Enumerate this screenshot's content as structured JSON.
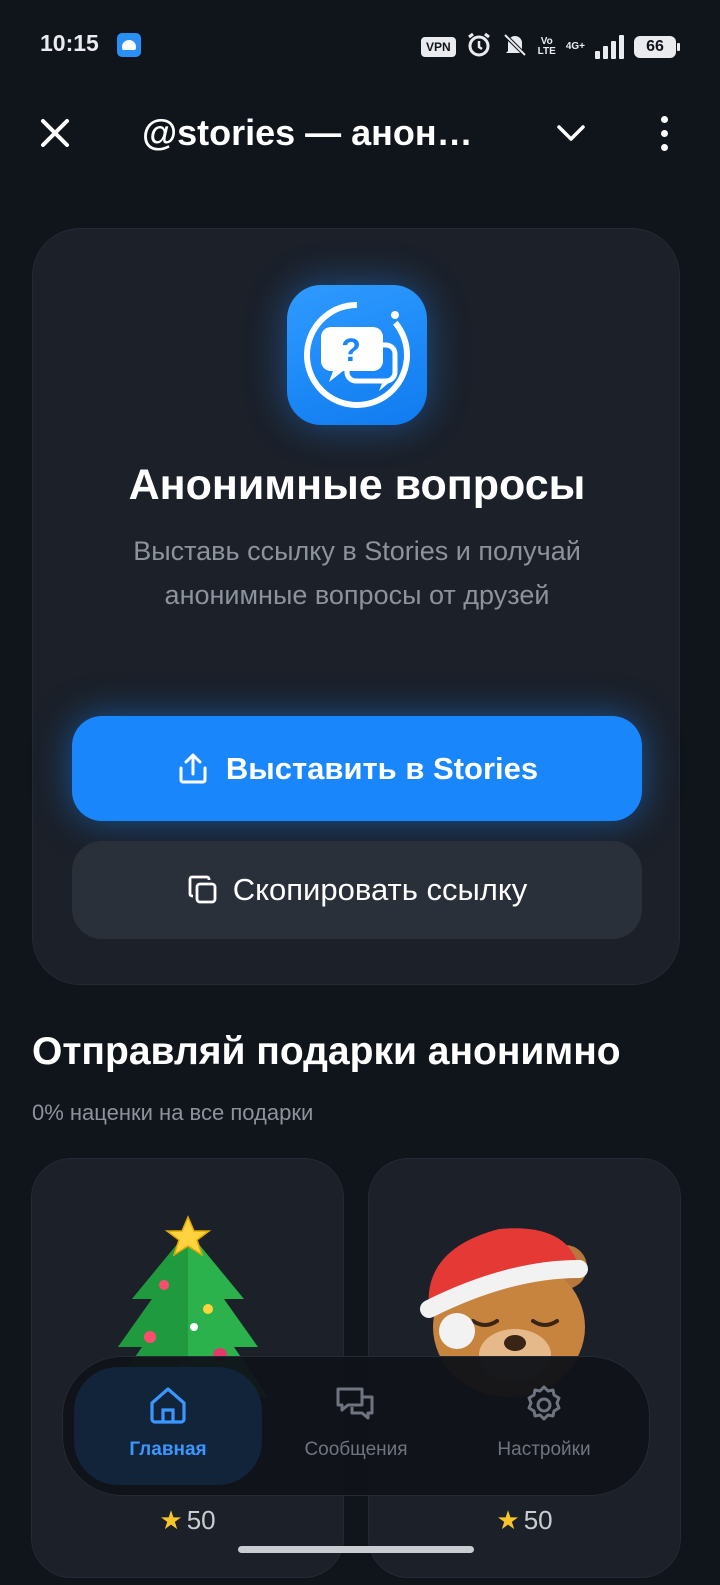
{
  "status_bar": {
    "time": "10:15",
    "vpn": "VPN",
    "volte_top": "Vo",
    "volte_bottom": "LTE",
    "network": "4G+",
    "battery": "66"
  },
  "header": {
    "title": "@stories — анонимные вопросы"
  },
  "hero": {
    "title": "Анонимные вопросы",
    "description": "Выставь ссылку в Stories и получай анонимные вопросы от друзей",
    "primary_button": "Выставить в Stories",
    "secondary_button": "Скопировать ссылку"
  },
  "gifts": {
    "title": "Отправляй подарки анонимно",
    "subtitle": "0% наценки на все подарки",
    "items": [
      {
        "name": "christmas-tree",
        "price": "50"
      },
      {
        "name": "teddy-bear-santa-hat",
        "price": "50"
      }
    ]
  },
  "nav": {
    "items": [
      {
        "label": "Главная",
        "icon": "home-icon",
        "active": true
      },
      {
        "label": "Сообщения",
        "icon": "chat-icon",
        "active": false
      },
      {
        "label": "Настройки",
        "icon": "gear-icon",
        "active": false
      }
    ]
  },
  "colors": {
    "background": "#10141b",
    "card": "#1b2029",
    "accent": "#1a86fb",
    "muted_text": "#8d939c"
  }
}
